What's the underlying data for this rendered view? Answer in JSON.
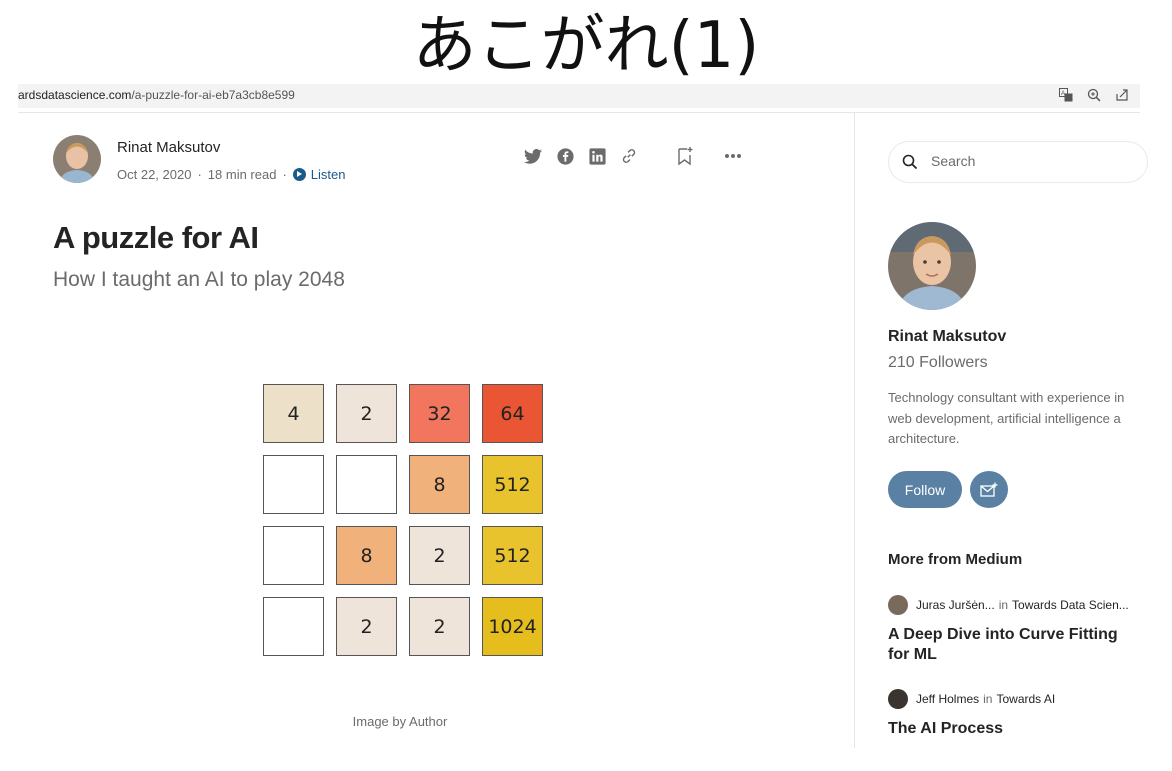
{
  "overlay_title": "あこがれ(1)",
  "browser": {
    "url_domain": "ardsdatascience.com",
    "url_path": "/a-puzzle-for-ai-eb7a3cb8e599"
  },
  "author": {
    "name": "Rinat Maksutov",
    "date": "Oct 22, 2020",
    "read_time": "18 min read",
    "listen_label": "Listen"
  },
  "article": {
    "title": "A puzzle for AI",
    "subtitle": "How I taught an AI to play 2048",
    "image_caption": "Image by Author"
  },
  "board": {
    "rows": [
      [
        "4",
        "2",
        "32",
        "64"
      ],
      [
        "",
        "",
        "8",
        "512"
      ],
      [
        "",
        "8",
        "2",
        "512"
      ],
      [
        "",
        "2",
        "2",
        "1024"
      ]
    ],
    "tile_colors": {
      "": "#ffffff",
      "2": "#eee4da",
      "4": "#ede0c8",
      "8": "#f0b27a",
      "32": "#f2755e",
      "64": "#ea5533",
      "512": "#e8c32e",
      "1024": "#e5bd1c"
    }
  },
  "sidebar": {
    "search_placeholder": "Search",
    "profile_name": "Rinat Maksutov",
    "followers": "210 Followers",
    "bio": [
      "Technology consultant with experience in",
      "web development, artificial intelligence a",
      "architecture."
    ],
    "follow_label": "Follow",
    "more_title": "More from Medium",
    "recommendations": [
      {
        "author": "Juras Juršėn...",
        "in_label": "in",
        "publication": "Towards Data Scien...",
        "title": "A Deep Dive into Curve Fitting for ML"
      },
      {
        "author": "Jeff Holmes",
        "in_label": "in",
        "publication": "Towards AI",
        "title": "The AI Process"
      }
    ]
  },
  "colors": {
    "accent": "#1a5a8a",
    "follow_button": "#5a80a4"
  }
}
